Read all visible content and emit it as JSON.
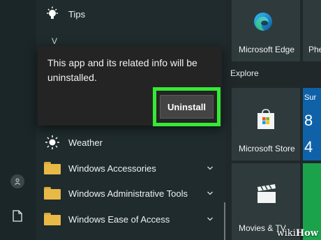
{
  "app_list": {
    "tips_label": "Tips",
    "section_letter": "V",
    "weather_label": "Weather",
    "folders": [
      {
        "label": "Windows Accessories"
      },
      {
        "label": "Windows Administrative Tools"
      },
      {
        "label": "Windows Ease of Access"
      }
    ]
  },
  "dialog": {
    "message": "This app and its related info will be uninstalled.",
    "uninstall_label": "Uninstall",
    "highlight_color": "#35ea34"
  },
  "tiles": {
    "edge_label": "Microsoft Edge",
    "partial_label": "Phe",
    "explore_label": "Explore",
    "store_label": "Microsoft Store",
    "movies_label": "Movies & TV",
    "weather_partial_day": "Sur",
    "weather_partial_temp": "8",
    "weather_partial_temp2": "4"
  },
  "watermark": {
    "prefix": "wiki",
    "suffix": "How"
  },
  "icons": [
    "lightbulb-icon",
    "sun-icon",
    "folder-icon",
    "chevron-down-icon",
    "user-icon",
    "document-icon",
    "edge-icon",
    "store-icon",
    "clapperboard-icon"
  ]
}
